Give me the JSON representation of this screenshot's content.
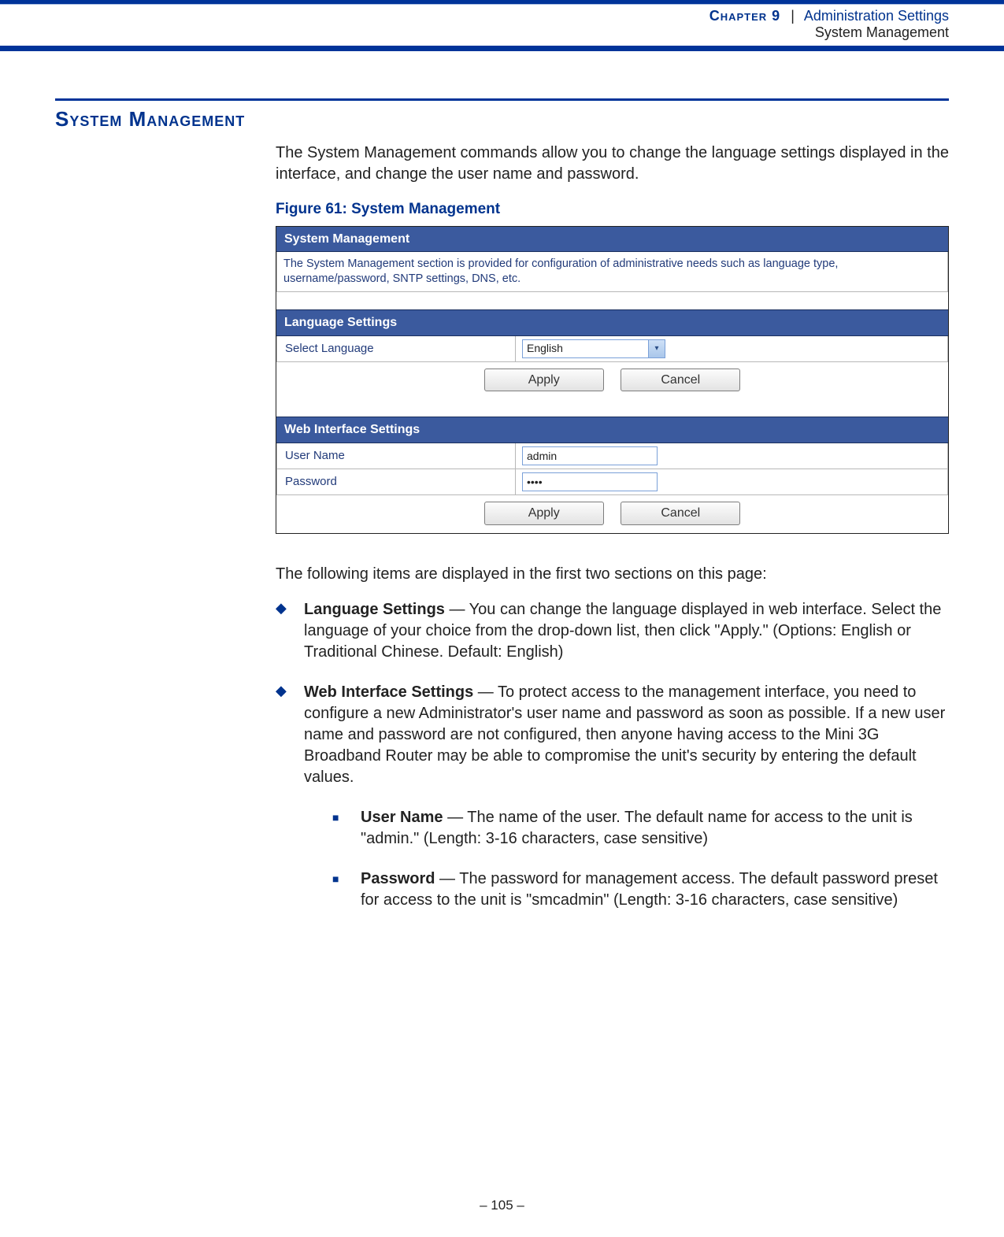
{
  "header": {
    "chapter": "Chapter 9",
    "sep": "|",
    "title": "Administration Settings",
    "subtitle": "System Management"
  },
  "section_heading": "System Management",
  "intro": "The System Management commands allow you to change the language settings displayed in the interface, and change the user name and password.",
  "figure_caption": "Figure 61:  System Management",
  "screenshot": {
    "title": "System Management",
    "info": "The System Management section is provided for configuration of administrative needs such as language type, username/password, SNTP settings, DNS, etc.",
    "lang_section": "Language Settings",
    "lang_label": "Select Language",
    "lang_value": "English",
    "web_section": "Web Interface Settings",
    "user_label": "User Name",
    "user_value": "admin",
    "pass_label": "Password",
    "pass_value": "••••",
    "apply": "Apply",
    "cancel": "Cancel"
  },
  "followup": "The following items are displayed in the first two sections on this page:",
  "bullets": {
    "lang": {
      "title": "Language Settings",
      "text": " — You can change the language displayed in web interface. Select the language of your choice from the drop-down list, then click \"Apply.\" (Options: English or Traditional Chinese. Default: English)"
    },
    "web": {
      "title": "Web Interface Settings",
      "text": " — To protect access to the management interface, you need to configure a new Administrator's user name and password as soon as possible. If a new user name and password are not configured, then anyone having access to the Mini 3G Broadband Router may be able to compromise the unit's security by entering the default values."
    },
    "user": {
      "title": "User Name",
      "text": " — The name of the user. The default name for access to the unit is \"admin.\" (Length: 3-16 characters, case sensitive)"
    },
    "pass": {
      "title": "Password",
      "text": " — The password for management access. The default password preset for access to the unit is \"smcadmin\" (Length: 3-16 characters, case sensitive)"
    }
  },
  "page_number": "–  105  –"
}
